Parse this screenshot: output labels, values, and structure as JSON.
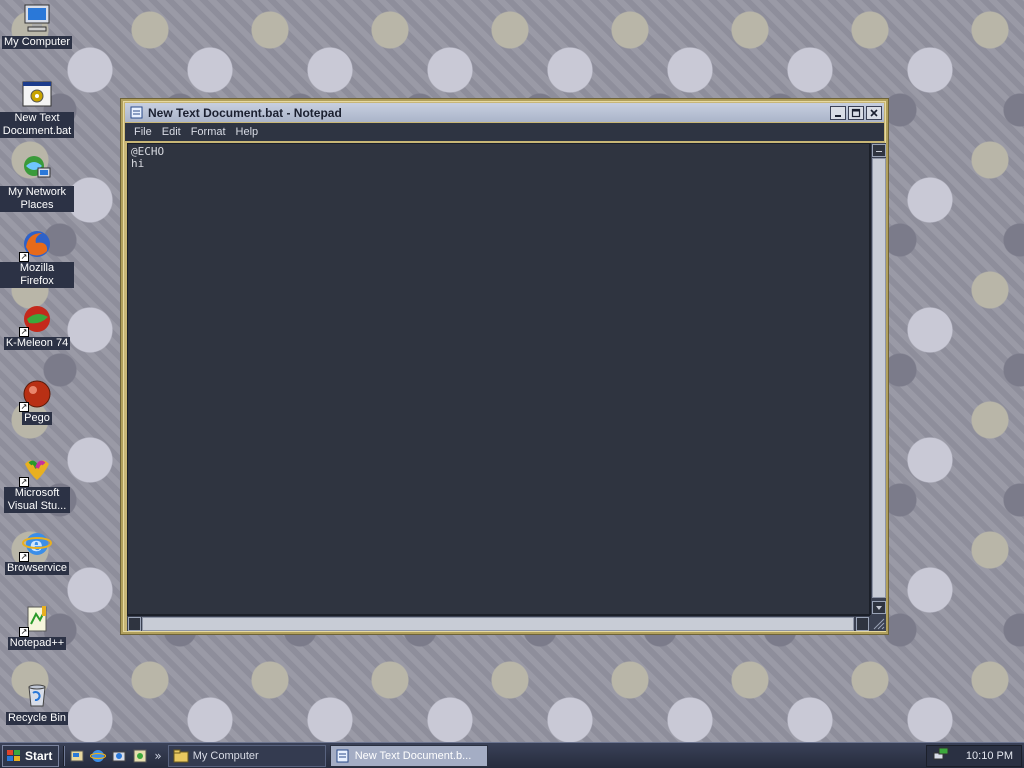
{
  "desktop": {
    "icons": [
      {
        "label": "My Computer",
        "icon": "computer-icon",
        "shortcut": false
      },
      {
        "label": "New Text Document.bat",
        "icon": "batch-file-icon",
        "shortcut": false
      },
      {
        "label": "My Network Places",
        "icon": "network-places-icon",
        "shortcut": false
      },
      {
        "label": "Mozilla Firefox",
        "icon": "firefox-icon",
        "shortcut": true
      },
      {
        "label": "K-Meleon 74",
        "icon": "k-meleon-icon",
        "shortcut": true
      },
      {
        "label": "Pego",
        "icon": "pego-icon",
        "shortcut": true
      },
      {
        "label": "Microsoft Visual Stu...",
        "icon": "visual-studio-icon",
        "shortcut": true
      },
      {
        "label": "Browservice",
        "icon": "internet-explorer-icon",
        "shortcut": true
      },
      {
        "label": "Notepad++",
        "icon": "notepad-plus-plus-icon",
        "shortcut": true
      },
      {
        "label": "Recycle Bin",
        "icon": "recycle-bin-icon",
        "shortcut": false
      }
    ]
  },
  "window": {
    "title": "New Text Document.bat - Notepad",
    "menu": [
      "File",
      "Edit",
      "Format",
      "Help"
    ],
    "content": "@ECHO\nhi",
    "controls": {
      "minimize": "minimize-icon",
      "maximize": "maximize-icon",
      "close": "close-icon"
    }
  },
  "taskbar": {
    "start_label": "Start",
    "quick_launch": [
      "show-desktop-icon",
      "internet-explorer-icon",
      "windows-explorer-icon",
      "media-icon"
    ],
    "chevron": "»",
    "tasks": [
      {
        "label": "My Computer",
        "icon": "folder-icon",
        "active": false
      },
      {
        "label": "New Text Document.b...",
        "icon": "notepad-icon",
        "active": true
      }
    ],
    "clock": "10:10 PM",
    "tray_icon": "network-tray-icon"
  },
  "colors": {
    "window_frame": "#c8b676",
    "editor_bg": "#2f3440",
    "taskbar_bg": "#2c3245",
    "label_bg": "#2c3245"
  }
}
